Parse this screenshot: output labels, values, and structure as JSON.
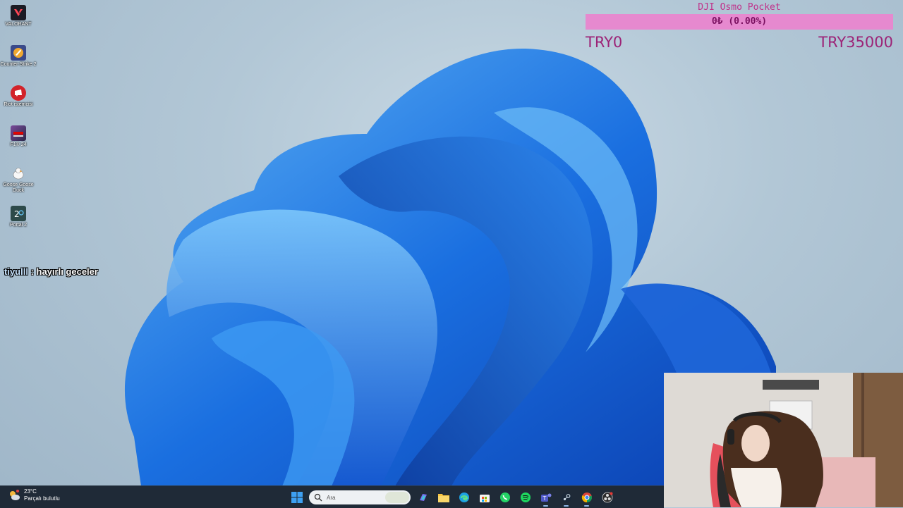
{
  "desktop": {
    "icons": [
      {
        "label": "VALORANT",
        "icon": "valorant-icon",
        "color": "#1b1b24"
      },
      {
        "label": "Counter-Strike 2",
        "icon": "counter-strike-icon",
        "color": "#3a4a8a"
      },
      {
        "label": "Riot istemcisi",
        "icon": "riot-client-icon",
        "color": "#d2232a"
      },
      {
        "label": "F1® 24",
        "icon": "f1-24-icon",
        "color": "#5a3a6a"
      },
      {
        "label": "Goose Goose Duck",
        "icon": "goose-goose-duck-icon",
        "color": "#f3f3f3"
      },
      {
        "label": "Portal 2",
        "icon": "portal-2-icon",
        "color": "#2d4a4a"
      }
    ]
  },
  "chat": {
    "username": "tiyulll",
    "separator": " : ",
    "message": "hayırlı geceler"
  },
  "donation_goal": {
    "title": "DJI Osmo Pocket",
    "progress_text": "0₺ (0.00%)",
    "progress_fraction": 0,
    "min_label": "TRY0",
    "max_label": "TRY35000",
    "bar_color": "#e689cf",
    "accent_color": "#c0318a"
  },
  "taskbar": {
    "weather_temp": "23°C",
    "weather_desc": "Parçalı bulutlu",
    "search_placeholder": "Ara",
    "apps": [
      {
        "icon": "copilot-icon",
        "active": false
      },
      {
        "icon": "file-explorer-icon",
        "active": false
      },
      {
        "icon": "edge-icon",
        "active": false
      },
      {
        "icon": "microsoft-store-icon",
        "active": false
      },
      {
        "icon": "whatsapp-icon",
        "active": false
      },
      {
        "icon": "spotify-icon",
        "active": false
      },
      {
        "icon": "teams-icon",
        "active": true
      },
      {
        "icon": "steam-icon",
        "active": true
      },
      {
        "icon": "chrome-icon",
        "active": true
      },
      {
        "icon": "obs-icon",
        "active": false
      }
    ]
  }
}
